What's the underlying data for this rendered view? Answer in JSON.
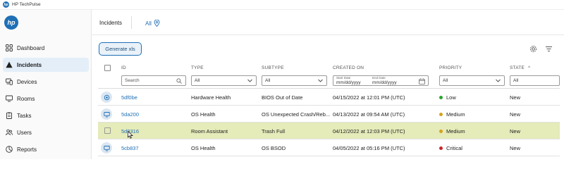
{
  "app": {
    "name": "HP TechPulse",
    "logo_text": "hp"
  },
  "sidebar": {
    "items": [
      {
        "label": "Dashboard",
        "icon": "grid-icon",
        "active": false
      },
      {
        "label": "Incidents",
        "icon": "warning-triangle-icon",
        "active": true
      },
      {
        "label": "Devices",
        "icon": "devices-icon",
        "active": false
      },
      {
        "label": "Rooms",
        "icon": "room-icon",
        "active": false
      },
      {
        "label": "Tasks",
        "icon": "clipboard-icon",
        "active": false
      },
      {
        "label": "Users",
        "icon": "users-icon",
        "active": false
      },
      {
        "label": "Reports",
        "icon": "reports-icon",
        "active": false
      }
    ]
  },
  "header": {
    "tab_incidents": "Incidents",
    "tab_all": "All",
    "tab_all_icon": "location-pin-icon"
  },
  "toolbar": {
    "generate_label": "Generate xls",
    "settings_icon": "gear-icon",
    "filter_icon": "filter-icon"
  },
  "table": {
    "columns": {
      "id": "ID",
      "type": "TYPE",
      "subtype": "SUBTYPE",
      "created_on": "CREATED ON",
      "priority": "PRIORITY",
      "state": "STATE"
    },
    "sort_indicator": "^",
    "filters": {
      "id_placeholder": "Search",
      "type_value": "All",
      "subtype_value": "All",
      "start_date_label": "Start Date",
      "end_date_label": "End Date",
      "start_date_placeholder": "mm/dd/yyyy",
      "end_date_placeholder": "mm/dd/yyyy",
      "priority_value": "All",
      "state_value": "All"
    },
    "rows": [
      {
        "icon": "room-device-icon",
        "id": "5df0be",
        "type": "Hardware Health",
        "subtype": "BIOS Out of Date",
        "created": "04/15/2022 at 12:01 PM (UTC)",
        "priority": "Low",
        "priority_color": "#2ea52e",
        "state": "New",
        "highlighted": false
      },
      {
        "icon": "monitor-icon",
        "id": "5da200",
        "type": "OS Health",
        "subtype": "OS Unexpected Crash/Reb...",
        "created": "04/13/2022 at 09:54 AM (UTC)",
        "priority": "Medium",
        "priority_color": "#d4a31c",
        "state": "New",
        "highlighted": false
      },
      {
        "icon": "checkbox",
        "id": "5d9316",
        "type": "Room Assistant",
        "subtype": "Trash Full",
        "created": "04/12/2022 at 12:03 PM (UTC)",
        "priority": "Medium",
        "priority_color": "#d4a31c",
        "state": "New",
        "highlighted": true
      },
      {
        "icon": "monitor-icon",
        "id": "5cb837",
        "type": "OS Health",
        "subtype": "OS BSOD",
        "created": "04/05/2022 at 05:16 PM (UTC)",
        "priority": "Critical",
        "priority_color": "#c62828",
        "state": "New",
        "highlighted": false
      }
    ]
  }
}
